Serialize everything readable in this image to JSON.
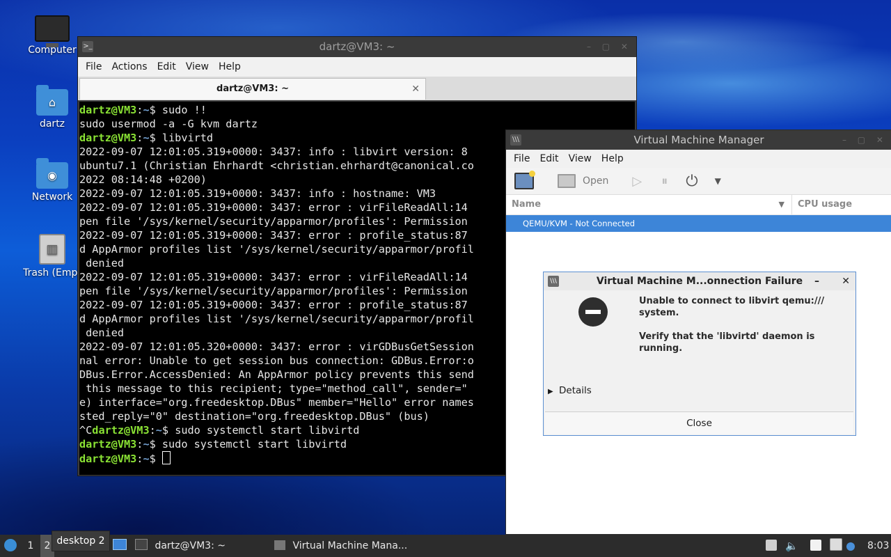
{
  "desktop": {
    "icons": [
      {
        "label": "Computer"
      },
      {
        "label": "dartz"
      },
      {
        "label": "Network"
      },
      {
        "label": "Trash (Empt"
      }
    ]
  },
  "terminal": {
    "title": "dartz@VM3: ~",
    "menu": [
      "File",
      "Actions",
      "Edit",
      "View",
      "Help"
    ],
    "tab_title": "dartz@VM3: ~",
    "prompt_user": "dartz@VM3",
    "prompt_colon": ":",
    "prompt_path": "~",
    "lines": [
      {
        "prompt": true,
        "cmd": "$ sudo !!"
      },
      {
        "text": "sudo usermod -a -G kvm dartz"
      },
      {
        "prompt": true,
        "cmd": "$ libvirtd"
      },
      {
        "text": "2022-09-07 12:01:05.319+0000: 3437: info : libvirt version: 8"
      },
      {
        "text": "ubuntu7.1 (Christian Ehrhardt <christian.ehrhardt@canonical.co"
      },
      {
        "text": "2022 08:14:48 +0200)"
      },
      {
        "text": "2022-09-07 12:01:05.319+0000: 3437: info : hostname: VM3"
      },
      {
        "text": "2022-09-07 12:01:05.319+0000: 3437: error : virFileReadAll:14"
      },
      {
        "text": "pen file '/sys/kernel/security/apparmor/profiles': Permission"
      },
      {
        "text": "2022-09-07 12:01:05.319+0000: 3437: error : profile_status:87"
      },
      {
        "text": "d AppArmor profiles list '/sys/kernel/security/apparmor/profil"
      },
      {
        "text": " denied"
      },
      {
        "text": "2022-09-07 12:01:05.319+0000: 3437: error : virFileReadAll:14"
      },
      {
        "text": "pen file '/sys/kernel/security/apparmor/profiles': Permission"
      },
      {
        "text": "2022-09-07 12:01:05.319+0000: 3437: error : profile_status:87"
      },
      {
        "text": "d AppArmor profiles list '/sys/kernel/security/apparmor/profil"
      },
      {
        "text": " denied"
      },
      {
        "text": "2022-09-07 12:01:05.320+0000: 3437: error : virGDBusGetSession"
      },
      {
        "text": "nal error: Unable to get session bus connection: GDBus.Error:o"
      },
      {
        "text": "DBus.Error.AccessDenied: An AppArmor policy prevents this send"
      },
      {
        "text": " this message to this recipient; type=\"method_call\", sender=\""
      },
      {
        "text": "e) interface=\"org.freedesktop.DBus\" member=\"Hello\" error names"
      },
      {
        "text": "sted_reply=\"0\" destination=\"org.freedesktop.DBus\" (bus)"
      },
      {
        "prompt": true,
        "pre": "^C",
        "cmd": "$ sudo systemctl start libvirtd"
      },
      {
        "prompt": true,
        "cmd": "$ sudo systemctl start libvirtd"
      },
      {
        "prompt": true,
        "cmd": "$ ",
        "cursor": true
      }
    ]
  },
  "vmm": {
    "title": "Virtual Machine Manager",
    "menu": [
      "File",
      "Edit",
      "View",
      "Help"
    ],
    "toolbar": {
      "open_label": "Open"
    },
    "columns": {
      "name": "Name",
      "cpu": "CPU usage"
    },
    "row": "QEMU/KVM - Not Connected"
  },
  "dialog": {
    "title": "Virtual Machine M...onnection Failure",
    "message1": "Unable to connect to libvirt qemu:///\nsystem.",
    "message2": "Verify that the 'libvirtd' daemon is\nrunning.",
    "details_label": "Details",
    "close_label": "Close"
  },
  "taskbar": {
    "workspace_1": "1",
    "workspace_2": "2",
    "tooltip": "desktop 2",
    "task_terminal": "dartz@VM3: ~",
    "task_vmm": "Virtual Machine Mana...",
    "clock": "8:03"
  }
}
